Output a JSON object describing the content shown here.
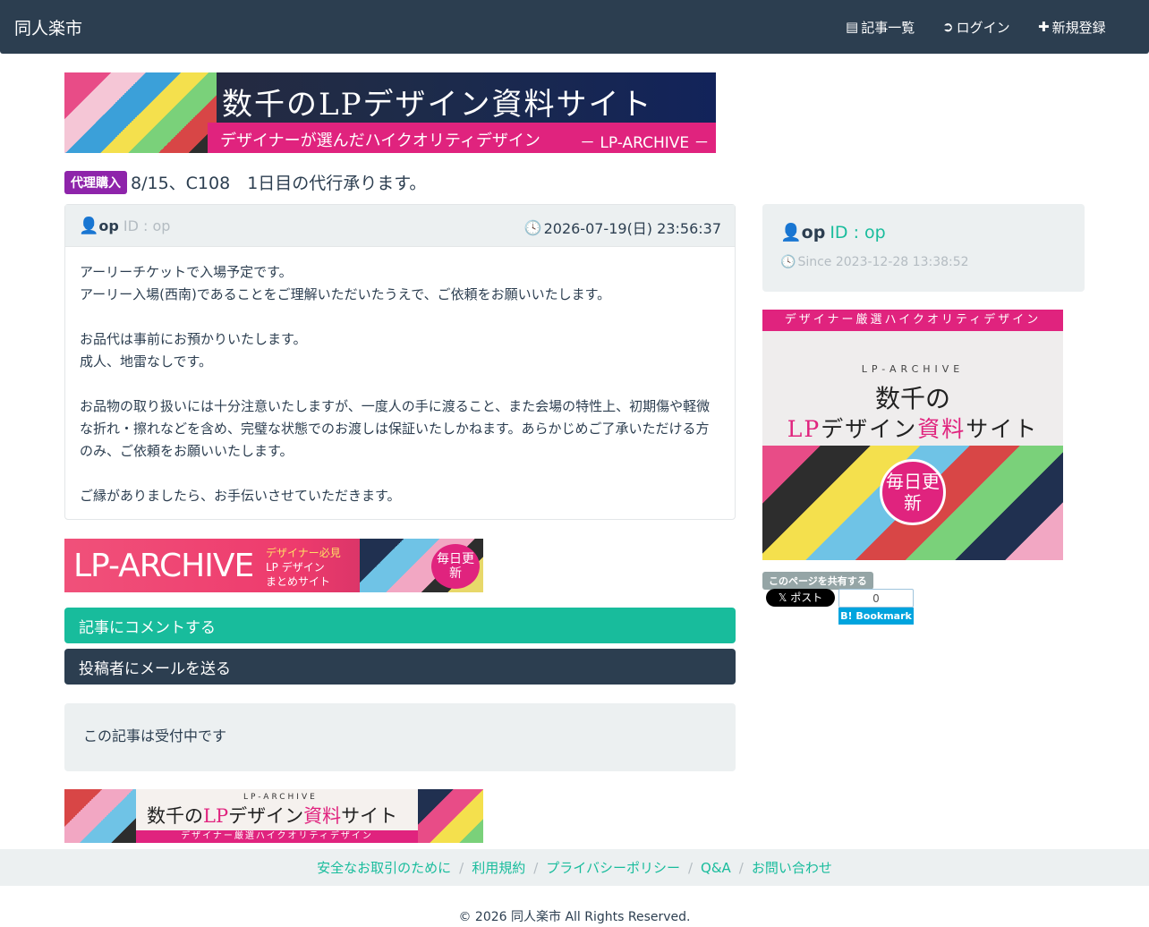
{
  "navbar": {
    "brand": "同人楽市",
    "items": [
      {
        "icon": "list-icon",
        "label": "記事一覧"
      },
      {
        "icon": "login-icon",
        "label": "ログイン"
      },
      {
        "icon": "plus-icon",
        "label": "新規登録"
      }
    ]
  },
  "banners": {
    "top": {
      "title": "数千のLPデザイン資料サイト",
      "subtitle": "デザイナーが選んだハイクオリティデザイン",
      "brand": "－ LP-ARCHIVE －"
    },
    "middle": {
      "logo": "LP-ARCHIVE",
      "line1": "デザイナー必見",
      "line2": "LP デザイン",
      "line3": "まとめサイト",
      "circle": "毎日更新"
    },
    "bottom": {
      "small": "LP-ARCHIVE",
      "title_a": "数千の",
      "title_b": "LP",
      "title_c": "デザイン",
      "title_d": "資料",
      "title_e": "サイト",
      "bar": "デザイナー厳選ハイクオリティデザイン"
    },
    "side": {
      "top": "デザイナー厳選ハイクオリティデザイン",
      "brand": "LP-ARCHIVE",
      "line1": "数千の",
      "line2a": "LP",
      "line2b": "デザイン",
      "line2c": "資料",
      "line2d": "サイト",
      "circle": "毎日更新"
    }
  },
  "article": {
    "badge": "代理購入",
    "title": "8/15、C108　1日目の代行承ります。",
    "author_name": "op",
    "author_id": "ID : op",
    "date": "2026-07-19(日) 23:56:37",
    "body": [
      "アーリーチケットで入場予定です。",
      "アーリー入場(西南)であることをご理解いただいたうえで、ご依頼をお願いいたします。",
      "",
      "お品代は事前にお預かりいたします。",
      "成人、地雷なしです。",
      "",
      "お品物の取り扱いには十分注意いたしますが、一度人の手に渡ること、また会場の特性上、初期傷や軽微な折れ・擦れなどを含め、完璧な状態でのお渡しは保証いたしかねます。あらかじめご了承いただける方のみ、ご依頼をお願いいたします。",
      "",
      "ご縁がありましたら、お手伝いさせていただきます。"
    ],
    "comment_button": "記事にコメントする",
    "mail_button": "投稿者にメールを送る",
    "status": "この記事は受付中です"
  },
  "sidebar": {
    "name": "op",
    "id": "ID : op",
    "since": "Since 2023-12-28 13:38:52",
    "share_label": "このページを共有する",
    "x_post": "𝕏 ポスト",
    "hatena_count": "0",
    "hatena_label": "B! Bookmark"
  },
  "footer": {
    "links": [
      "安全なお取引のために",
      "利用規約",
      "プライバシーポリシー",
      "Q&A",
      "お問い合わせ"
    ],
    "copyright": "© 2026 同人楽市 All Rights Reserved."
  },
  "colors": {
    "navbar": "#2c3e50",
    "accent": "#18bc9c",
    "badge": "#8e24aa",
    "pink": "#e0237e"
  }
}
